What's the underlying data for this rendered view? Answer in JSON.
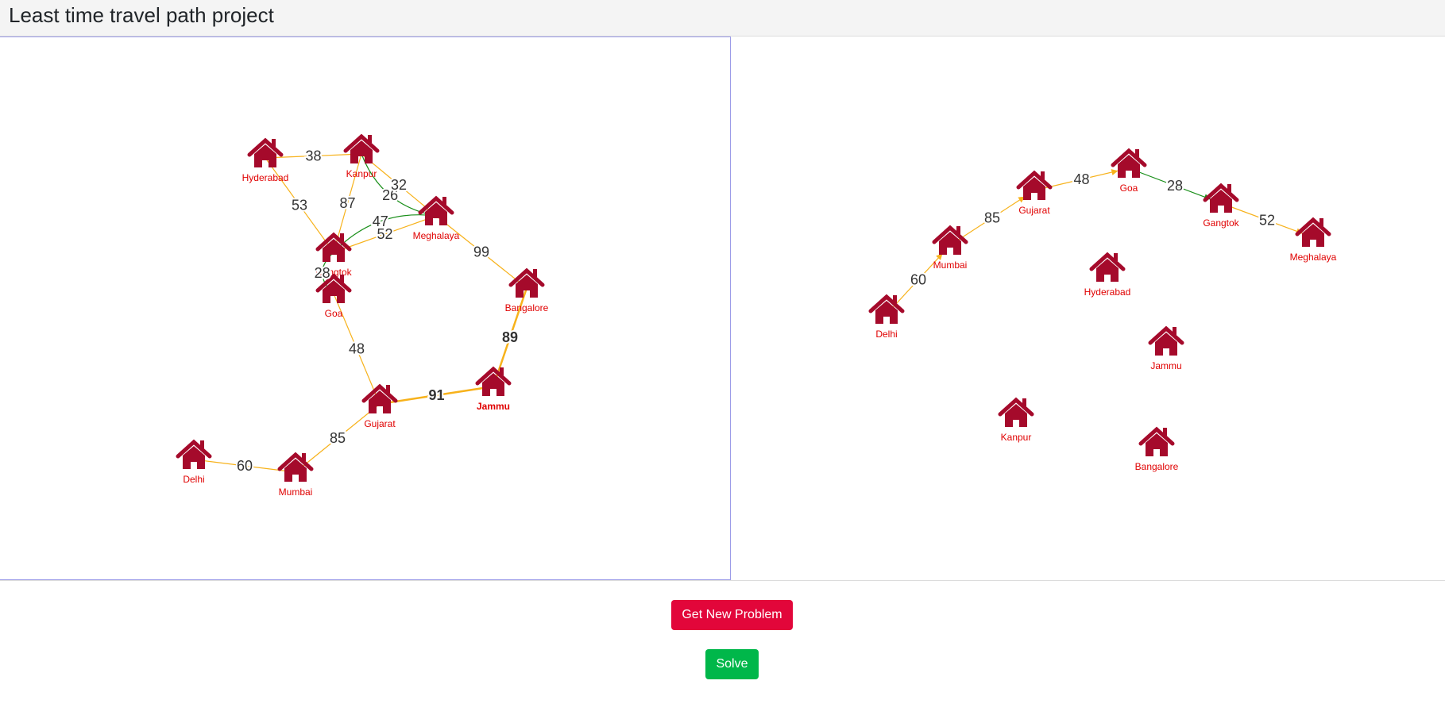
{
  "header": {
    "title": "Least time travel path project"
  },
  "buttons": {
    "new_problem": "Get New Problem",
    "solve": "Solve"
  },
  "colors": {
    "house": "#a50a2b",
    "node_label": "#e00000",
    "edge_default": "#f7b21b",
    "edge_highlight": "#1a8f1a",
    "edge_label": "#333333",
    "new_problem_button": "#e2063a",
    "solve_button": "#00b74a"
  },
  "icons": {
    "city_node": "house-icon"
  },
  "problem_graph": {
    "nodes": [
      {
        "id": "Hyderabad",
        "label": "Hyderabad"
      },
      {
        "id": "Kanpur",
        "label": "Kanpur"
      },
      {
        "id": "Meghalaya",
        "label": "Meghalaya"
      },
      {
        "id": "Gangtok",
        "label": "Gangtok"
      },
      {
        "id": "Goa",
        "label": "Goa"
      },
      {
        "id": "Bangalore",
        "label": "Bangalore"
      },
      {
        "id": "Jammu",
        "label": "Jammu",
        "bold": true
      },
      {
        "id": "Gujarat",
        "label": "Gujarat"
      },
      {
        "id": "Delhi",
        "label": "Delhi"
      },
      {
        "id": "Mumbai",
        "label": "Mumbai"
      }
    ],
    "edges": [
      {
        "from": "Hyderabad",
        "to": "Kanpur",
        "label": "38",
        "color": "default"
      },
      {
        "from": "Kanpur",
        "to": "Meghalaya",
        "label": "26",
        "color": "highlight",
        "curved": true
      },
      {
        "from": "Kanpur",
        "to": "Meghalaya",
        "label": "32",
        "color": "default"
      },
      {
        "from": "Hyderabad",
        "to": "Gangtok",
        "label": "53",
        "color": "default"
      },
      {
        "from": "Kanpur",
        "to": "Gangtok",
        "label": "87",
        "color": "default"
      },
      {
        "from": "Gangtok",
        "to": "Meghalaya",
        "label": "52",
        "color": "default"
      },
      {
        "from": "Gangtok",
        "to": "Meghalaya",
        "label": "47",
        "color": "highlight",
        "curved": true
      },
      {
        "from": "Meghalaya",
        "to": "Bangalore",
        "label": "99",
        "color": "default"
      },
      {
        "from": "Gangtok",
        "to": "Goa",
        "label": "28",
        "color": "highlight",
        "curved": true
      },
      {
        "from": "Goa",
        "to": "Gujarat",
        "label": "48",
        "color": "default"
      },
      {
        "from": "Bangalore",
        "to": "Jammu",
        "label": "89",
        "color": "default",
        "bold": true
      },
      {
        "from": "Gujarat",
        "to": "Jammu",
        "label": "91",
        "color": "default",
        "bold": true
      },
      {
        "from": "Gujarat",
        "to": "Mumbai",
        "label": "85",
        "color": "default"
      },
      {
        "from": "Delhi",
        "to": "Mumbai",
        "label": "60",
        "color": "default"
      }
    ]
  },
  "solution_graph": {
    "nodes": [
      {
        "id": "Delhi",
        "label": "Delhi"
      },
      {
        "id": "Mumbai",
        "label": "Mumbai"
      },
      {
        "id": "Gujarat",
        "label": "Gujarat"
      },
      {
        "id": "Goa",
        "label": "Goa"
      },
      {
        "id": "Gangtok",
        "label": "Gangtok"
      },
      {
        "id": "Meghalaya",
        "label": "Meghalaya"
      },
      {
        "id": "Hyderabad",
        "label": "Hyderabad"
      },
      {
        "id": "Jammu",
        "label": "Jammu"
      },
      {
        "id": "Kanpur",
        "label": "Kanpur"
      },
      {
        "id": "Bangalore",
        "label": "Bangalore"
      }
    ],
    "edges": [
      {
        "from": "Delhi",
        "to": "Mumbai",
        "label": "60",
        "color": "default"
      },
      {
        "from": "Mumbai",
        "to": "Gujarat",
        "label": "85",
        "color": "default"
      },
      {
        "from": "Gujarat",
        "to": "Goa",
        "label": "48",
        "color": "default"
      },
      {
        "from": "Goa",
        "to": "Gangtok",
        "label": "28",
        "color": "highlight"
      },
      {
        "from": "Gangtok",
        "to": "Meghalaya",
        "label": "52",
        "color": "default"
      }
    ]
  }
}
